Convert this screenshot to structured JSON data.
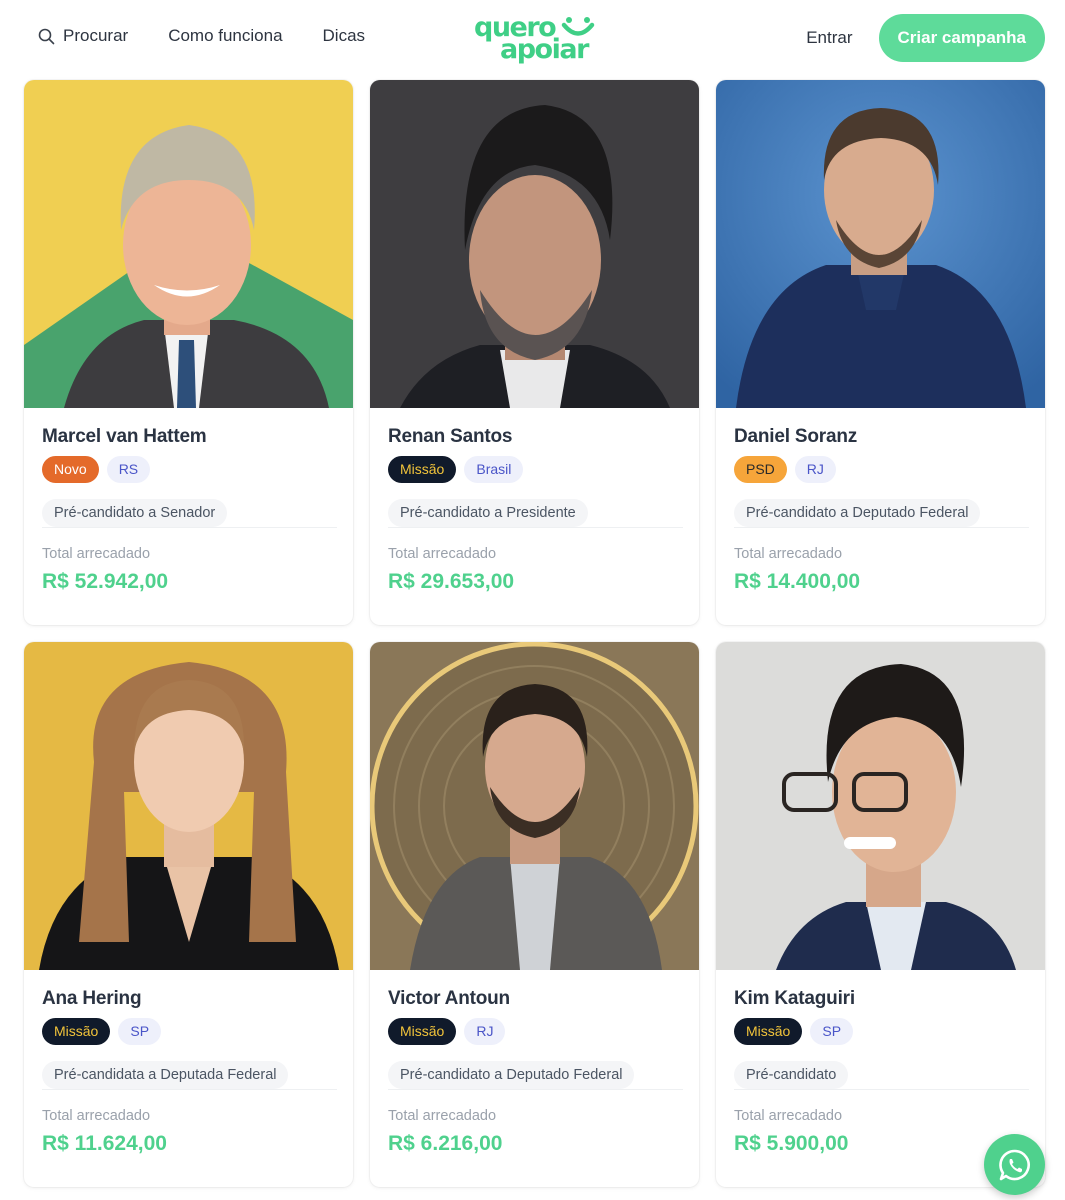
{
  "header": {
    "search_label": "Procurar",
    "how_label": "Como funciona",
    "tips_label": "Dicas",
    "logo_line1": "quero",
    "logo_line2": "apoiar",
    "login_label": "Entrar",
    "cta_label": "Criar campanha"
  },
  "colors": {
    "brand_green": "#4fd18d",
    "party_novo": "#e46a2a",
    "party_missao": "#101a2b",
    "party_missao_text": "#f2c43a",
    "party_psd": "#f6a53a",
    "state_tag_bg": "#eef0fb"
  },
  "raised_label": "Total arrecadado",
  "candidates": [
    {
      "name": "Marcel van Hattem",
      "party": "Novo",
      "state": "RS",
      "role": "Pré-candidato a Senador",
      "amount": "R$ 52.942,00"
    },
    {
      "name": "Renan Santos",
      "party": "Missão",
      "state": "Brasil",
      "role": "Pré-candidato a Presidente",
      "amount": "R$ 29.653,00"
    },
    {
      "name": "Daniel Soranz",
      "party": "PSD",
      "state": "RJ",
      "role": "Pré-candidato a Deputado Federal",
      "amount": "R$ 14.400,00"
    },
    {
      "name": "Ana Hering",
      "party": "Missão",
      "state": "SP",
      "role": "Pré-candidata a Deputada Federal",
      "amount": "R$ 11.624,00"
    },
    {
      "name": "Victor Antoun",
      "party": "Missão",
      "state": "RJ",
      "role": "Pré-candidato a Deputado Federal",
      "amount": "R$ 6.216,00"
    },
    {
      "name": "Kim Kataguiri",
      "party": "Missão",
      "state": "SP",
      "role": "Pré-candidato",
      "amount": "R$ 5.900,00"
    }
  ],
  "whatsapp_icon": "whatsapp-icon"
}
